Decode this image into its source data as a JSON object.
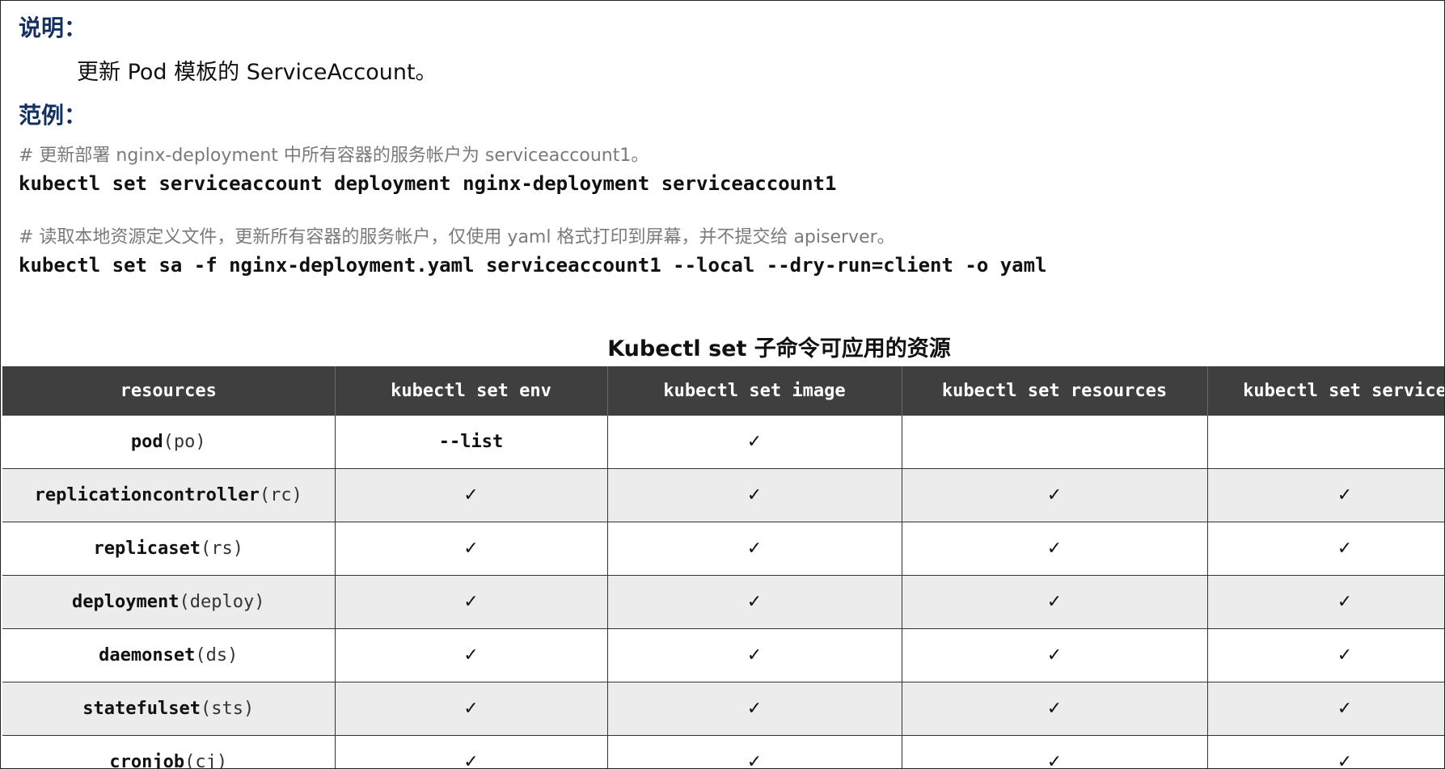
{
  "section_desc": {
    "heading": "说明：",
    "text": "更新 Pod 模板的 ServiceAccount。"
  },
  "section_example": {
    "heading": "范例：",
    "examples": [
      {
        "comment": "# 更新部署 nginx-deployment 中所有容器的服务帐户为 serviceaccount1。",
        "command": "kubectl set serviceaccount deployment nginx-deployment serviceaccount1"
      },
      {
        "comment": "# 读取本地资源定义文件，更新所有容器的服务帐户，仅使用 yaml 格式打印到屏幕，并不提交给 apiserver。",
        "command": "kubectl set sa -f nginx-deployment.yaml serviceaccount1 --local --dry-run=client -o yaml"
      }
    ]
  },
  "table": {
    "caption": "Kubectl set 子命令可应用的资源",
    "headers": [
      "resources",
      "kubectl set env",
      "kubectl set image",
      "kubectl set resources",
      "kubectl set service"
    ],
    "rows": [
      {
        "name": "pod",
        "abbr": "(po)",
        "cells": [
          "--list",
          "✓",
          "",
          ""
        ]
      },
      {
        "name": "replicationcontroller",
        "abbr": "(rc)",
        "cells": [
          "✓",
          "✓",
          "✓",
          "✓"
        ]
      },
      {
        "name": "replicaset",
        "abbr": "(rs)",
        "cells": [
          "✓",
          "✓",
          "✓",
          "✓"
        ]
      },
      {
        "name": "deployment",
        "abbr": "(deploy)",
        "cells": [
          "✓",
          "✓",
          "✓",
          "✓"
        ]
      },
      {
        "name": "daemonset",
        "abbr": "(ds)",
        "cells": [
          "✓",
          "✓",
          "✓",
          "✓"
        ]
      },
      {
        "name": "statefulset",
        "abbr": "(sts)",
        "cells": [
          "✓",
          "✓",
          "✓",
          "✓"
        ]
      },
      {
        "name": "cronjob",
        "abbr": "(cj)",
        "cells": [
          "✓",
          "✓",
          "✓",
          "✓"
        ]
      }
    ]
  },
  "colors": {
    "heading": "#14305f",
    "header_bg": "#3f3f3f",
    "row_alt_bg": "#ececec",
    "comment": "#7a7a7a"
  }
}
